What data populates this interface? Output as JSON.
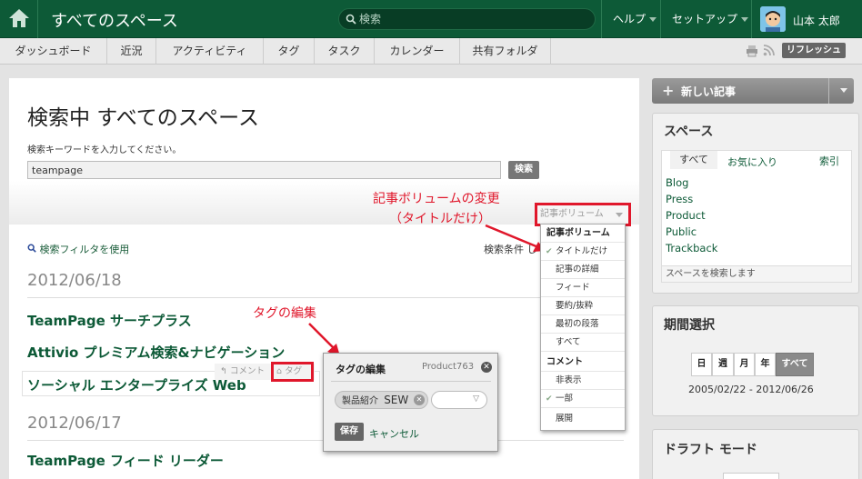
{
  "header": {
    "space_title": "すべてのスペース",
    "search_placeholder": "検索",
    "help": "ヘルプ",
    "setup": "セットアップ",
    "user_name": "山本 太郎"
  },
  "nav": {
    "tabs": [
      "ダッシュボード",
      "近況",
      "アクティビティ",
      "タグ",
      "タスク",
      "カレンダー",
      "共有フォルダ"
    ],
    "refresh": "リフレッシュ"
  },
  "main": {
    "title": "検索中 すべてのスペース",
    "prompt": "検索キーワードを入力してください。",
    "keyword": "teampage",
    "search_button": "検索",
    "volume_dropdown": "記事ボリューム",
    "filter_link": "検索フィルタを使用",
    "conditions_label": "検索条件",
    "conditions_trunc": "し",
    "groups": [
      {
        "date": "2012/06/18",
        "items": [
          "TeamPage サーチプラス",
          "Attivio プレミアム検索&ナビゲーション",
          "ソーシャル エンタープライズ Web"
        ]
      },
      {
        "date": "2012/06/17",
        "items": [
          "TeamPage フィード リーダー"
        ]
      }
    ],
    "row_actions": {
      "comment": "コメント",
      "tag": "タグ"
    }
  },
  "annotations": {
    "volume_change_line1": "記事ボリュームの変更",
    "volume_change_line2": "（タイトルだけ）",
    "tag_edit": "タグの編集"
  },
  "volume_menu": {
    "header_volume": "記事ボリューム",
    "volume_items": [
      "タイトルだけ",
      "記事の詳細",
      "フィード",
      "要約/抜粋",
      "最初の段落",
      "すべて"
    ],
    "header_comment": "コメント",
    "comment_items": [
      "非表示",
      "一部",
      "展開"
    ]
  },
  "tag_popup": {
    "title": "タグの編集",
    "context": "Product763",
    "chip_category": "製品紹介",
    "chip_value": "SEW",
    "save": "保存",
    "cancel": "キャンセル"
  },
  "sidebar": {
    "new_post": "新しい記事",
    "spaces_title": "スペース",
    "tab_all": "すべて",
    "tab_fav": "お気に入り",
    "index": "索引",
    "spaces": [
      "Blog",
      "Press",
      "Product",
      "Public",
      "Trackback"
    ],
    "space_search_placeholder": "スペースを検索します",
    "period_title": "期間選択",
    "period_buttons": [
      "日",
      "週",
      "月",
      "年",
      "すべて"
    ],
    "period_range": "2005/02/22 - 2012/06/26",
    "draft_title": "ドラフト モード"
  },
  "colors": {
    "brand": "#0d5a37",
    "annotation": "#e0172b"
  }
}
